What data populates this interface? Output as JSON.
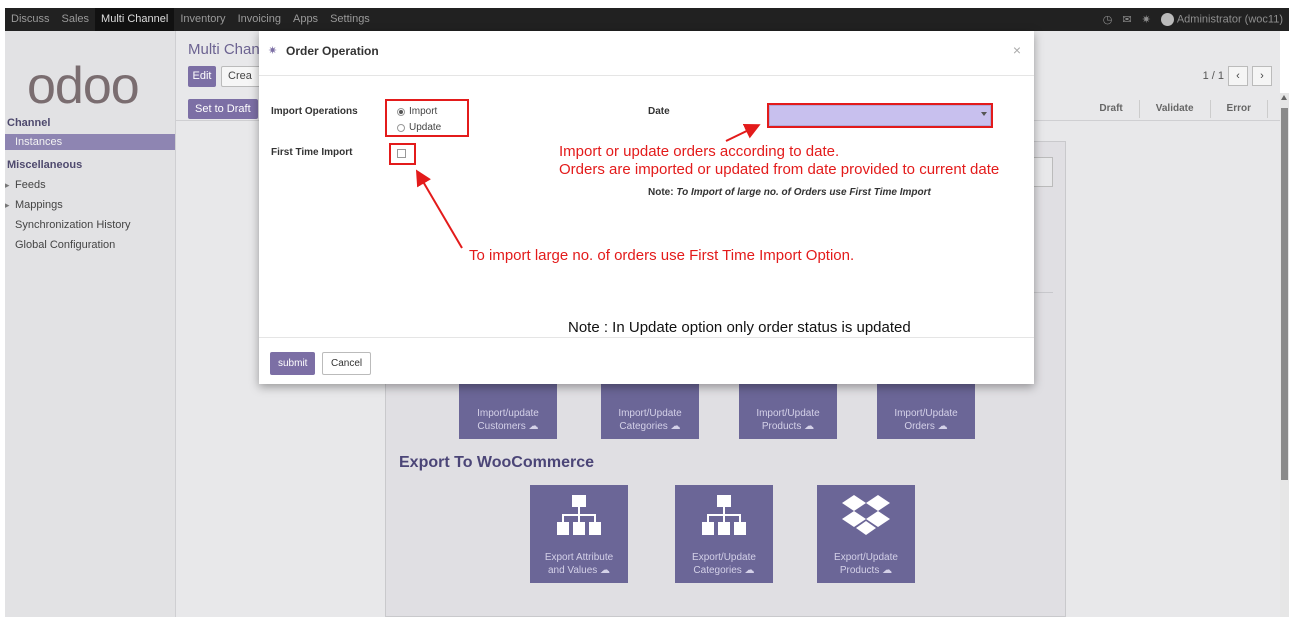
{
  "nav": {
    "items": [
      "Discuss",
      "Sales",
      "Multi Channel",
      "Inventory",
      "Invoicing",
      "Apps",
      "Settings"
    ],
    "active_index": 2,
    "user": "Administrator (woc11)"
  },
  "logo": "odoo",
  "sidebar": {
    "channel_heading": "Channel",
    "instances": "Instances",
    "misc_heading": "Miscellaneous",
    "feeds": "Feeds",
    "mappings": "Mappings",
    "sync_history": "Synchronization History",
    "global_config": "Global Configuration"
  },
  "main": {
    "breadcrumb": "Multi Chann",
    "edit": "Edit",
    "create": "Crea",
    "pager": "1 / 1",
    "set_to_draft": "Set to Draft",
    "stages": [
      "Draft",
      "Validate",
      "Error"
    ],
    "export_heading": "Export To WooCommerce",
    "import_tiles": [
      {
        "line1": "Import/update",
        "line2": "Customers"
      },
      {
        "line1": "Import/Update",
        "line2": "Categories"
      },
      {
        "line1": "Import/Update",
        "line2": "Products"
      },
      {
        "line1": "Import/Update",
        "line2": "Orders"
      }
    ],
    "export_tiles": [
      {
        "line1": "Export Attribute",
        "line2": "and Values"
      },
      {
        "line1": "Export/Update",
        "line2": "Categories"
      },
      {
        "line1": "Export/Update",
        "line2": "Products"
      }
    ]
  },
  "modal": {
    "title": "Order Operation",
    "import_operations_label": "Import Operations",
    "option_import": "Import",
    "option_update": "Update",
    "first_time_label": "First Time Import",
    "date_label": "Date",
    "date_value": "",
    "note_prefix": "Note:",
    "note_text": "To Import of large no. of Orders use First Time Import",
    "submit": "submit",
    "cancel": "Cancel"
  },
  "annotations": {
    "date_line1": "Import or update orders according to date.",
    "date_line2": "Orders are imported or updated from date provided to current date",
    "first_time": "To import large no. of  orders use First Time Import Option.",
    "update_note": "Note :  In Update option only order status is updated"
  },
  "colors": {
    "annotation_red": "#e31b1b",
    "brand_purple": "#7c6fa5",
    "date_field": "#c8c0ee"
  }
}
